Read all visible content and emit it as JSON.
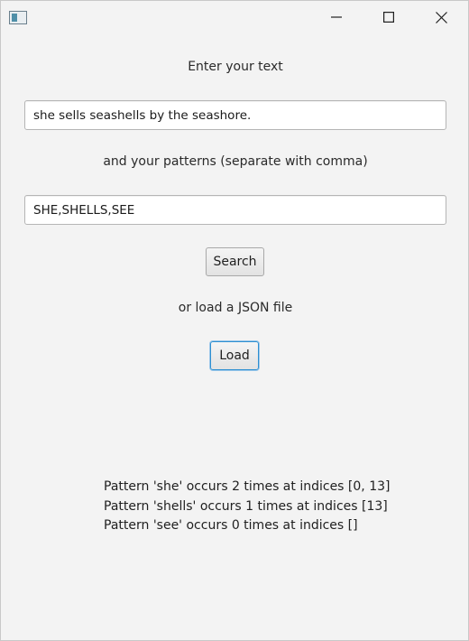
{
  "window": {
    "controls": {
      "minimize": "minimize",
      "maximize": "maximize",
      "close": "close"
    }
  },
  "form": {
    "text_label": "Enter your text",
    "text_value": "she sells seashells by the seashore.",
    "patterns_label": "and your patterns (separate with comma)",
    "patterns_value": "SHE,SHELLS,SEE",
    "search_button": "Search",
    "load_label": "or load a JSON file",
    "load_button": "Load"
  },
  "results": [
    "Pattern 'she' occurs 2 times at indices [0, 13]",
    "Pattern 'shells' occurs 1 times at indices [13]",
    "Pattern 'see' occurs 0 times at indices []"
  ],
  "icons": {
    "app": "app-window-icon",
    "minimize": "minimize-icon",
    "maximize": "maximize-icon",
    "close": "close-icon"
  }
}
